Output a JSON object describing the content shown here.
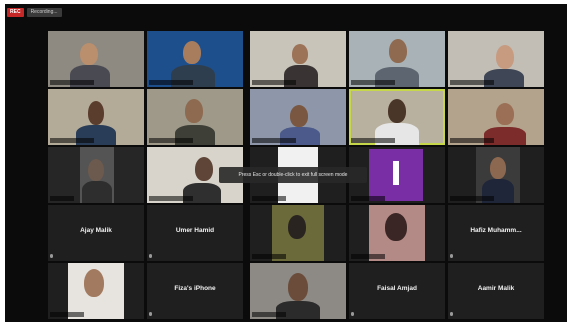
{
  "recording": {
    "badge": "REC",
    "label": "Recording..."
  },
  "overlay": {
    "message": "Press Esc or double-click to exit full screen mode"
  },
  "tiles": {
    "ajay": "Ajay Malik",
    "umar": "Umer Hamid",
    "hafiz": "Hafiz Muhamm...",
    "fizas_iphone": "Fiza's iPhone",
    "faisal": "Faisal Amjad",
    "aamir": "Aamir Malik"
  }
}
